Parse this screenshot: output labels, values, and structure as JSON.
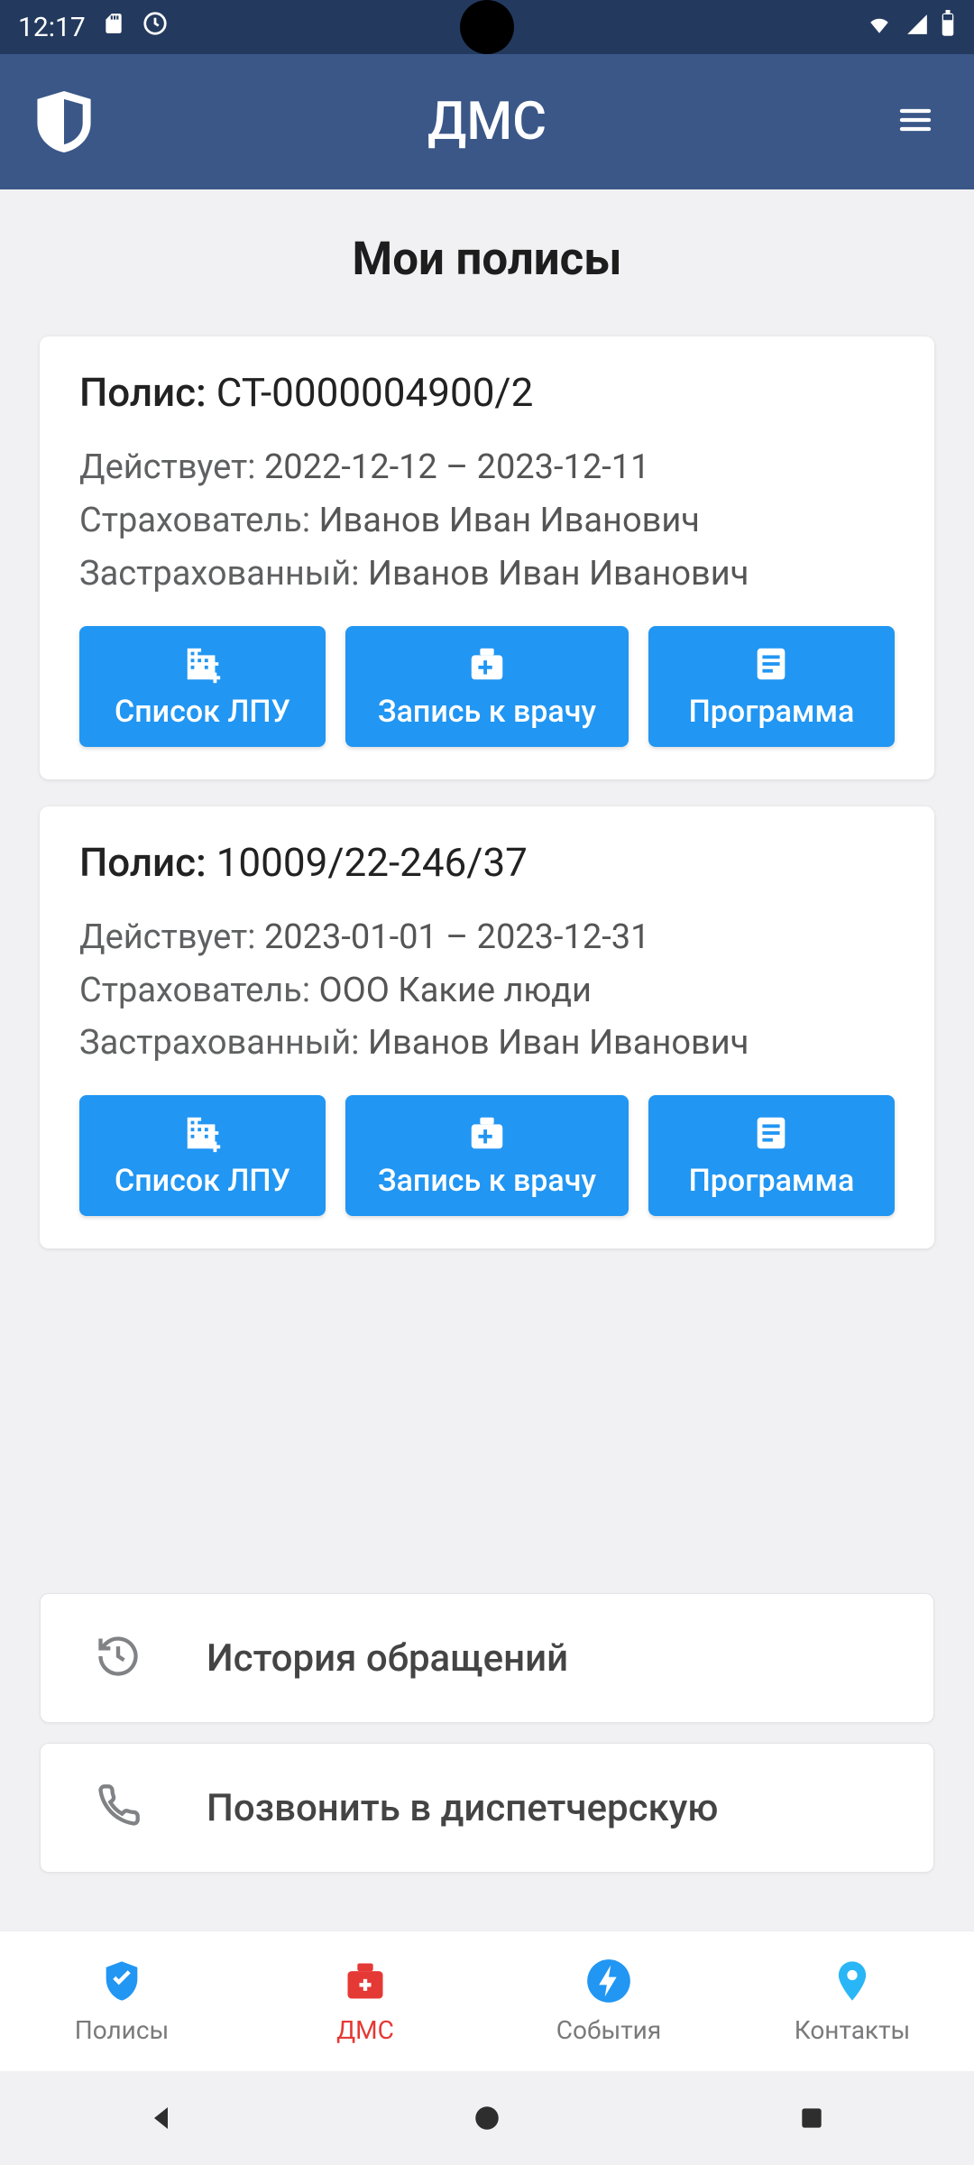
{
  "status": {
    "time": "12:17"
  },
  "header": {
    "title": "ДМС"
  },
  "page_heading": "Мои полисы",
  "labels": {
    "policy_prefix": "Полис: ",
    "valid": "Действует: ",
    "insurer": "Страхователь: ",
    "insured": "Застрахованный: "
  },
  "policies": [
    {
      "number": "СТ-0000004900/2",
      "valid": "2022-12-12 – 2023-12-11",
      "insurer": "Иванов Иван Иванович",
      "insured": "Иванов Иван Иванович"
    },
    {
      "number": "10009/22-246/37",
      "valid": "2023-01-01 – 2023-12-31",
      "insurer": "ООО Какие люди",
      "insured": "Иванов Иван Иванович"
    }
  ],
  "policy_buttons": {
    "list_lpu": "Список ЛПУ",
    "appointment": "Запись к врачу",
    "program": "Программа"
  },
  "quick_actions": {
    "history": "История обращений",
    "call_dispatch": "Позвонить в диспетчерскую"
  },
  "tabs": {
    "policies": "Полисы",
    "dms": "ДМС",
    "events": "События",
    "contacts": "Контакты"
  },
  "colors": {
    "shield_blue": "#2196f3",
    "medkit_red": "#e53935",
    "pin_cyan": "#29b6f6"
  }
}
